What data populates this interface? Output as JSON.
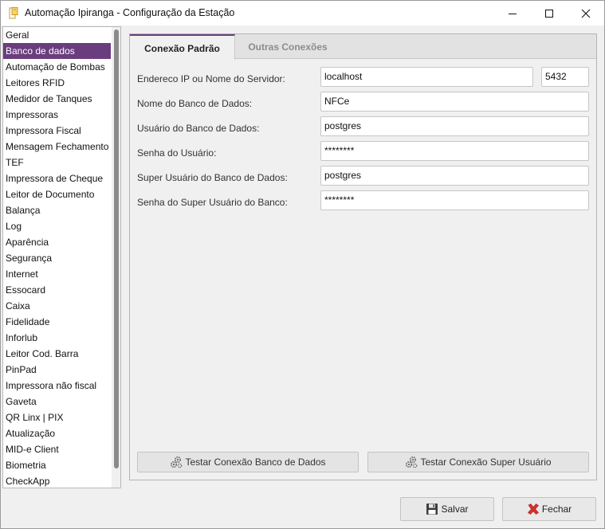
{
  "window": {
    "title": "Automação Ipiranga - Configuração da Estação",
    "icons": [
      "app-icon",
      "minimize-icon",
      "maximize-icon",
      "close-icon"
    ]
  },
  "sidebar": {
    "selected_index": 1,
    "items": [
      {
        "label": "Geral"
      },
      {
        "label": "Banco de dados"
      },
      {
        "label": "Automação de Bombas"
      },
      {
        "label": "Leitores RFID"
      },
      {
        "label": "Medidor de Tanques"
      },
      {
        "label": "Impressoras"
      },
      {
        "label": "Impressora Fiscal"
      },
      {
        "label": "Mensagem Fechamento"
      },
      {
        "label": "TEF"
      },
      {
        "label": "Impressora de Cheque"
      },
      {
        "label": "Leitor de Documento"
      },
      {
        "label": "Balança"
      },
      {
        "label": "Log"
      },
      {
        "label": "Aparência"
      },
      {
        "label": "Segurança"
      },
      {
        "label": "Internet"
      },
      {
        "label": "Essocard"
      },
      {
        "label": "Caixa"
      },
      {
        "label": "Fidelidade"
      },
      {
        "label": "Inforlub"
      },
      {
        "label": "Leitor Cod. Barra"
      },
      {
        "label": "PinPad"
      },
      {
        "label": "Impressora não fiscal"
      },
      {
        "label": "Gaveta"
      },
      {
        "label": "QR Linx | PIX"
      },
      {
        "label": "Atualização"
      },
      {
        "label": "MID-e Client"
      },
      {
        "label": "Biometria"
      },
      {
        "label": "CheckApp"
      }
    ]
  },
  "tabs": [
    {
      "label": "Conexão Padrão",
      "active": true
    },
    {
      "label": "Outras Conexões",
      "active": false
    }
  ],
  "form": {
    "server_label": "Endereco IP ou Nome do Servidor:",
    "server_value": "localhost",
    "port_value": "5432",
    "dbname_label": "Nome do Banco de Dados:",
    "dbname_value": "NFCe",
    "dbuser_label": "Usuário do Banco de Dados:",
    "dbuser_value": "postgres",
    "password_label": "Senha do Usuário:",
    "password_value": "********",
    "superuser_label": "Super Usuário do Banco de Dados:",
    "superuser_value": "postgres",
    "superpass_label": "Senha do Super Usuário do Banco:",
    "superpass_value": "********"
  },
  "actions": {
    "test_db_label": "Testar Conexão Banco de Dados",
    "test_super_label": "Testar Conexão Super Usuário",
    "icon": "gears-icon"
  },
  "footer": {
    "save_label": "Salvar",
    "save_icon": "floppy-disk-icon",
    "close_label": "Fechar",
    "close_icon": "red-x-icon"
  },
  "colors": {
    "accent": "#6a3d7e",
    "close_icon_red": "#d9302c"
  }
}
